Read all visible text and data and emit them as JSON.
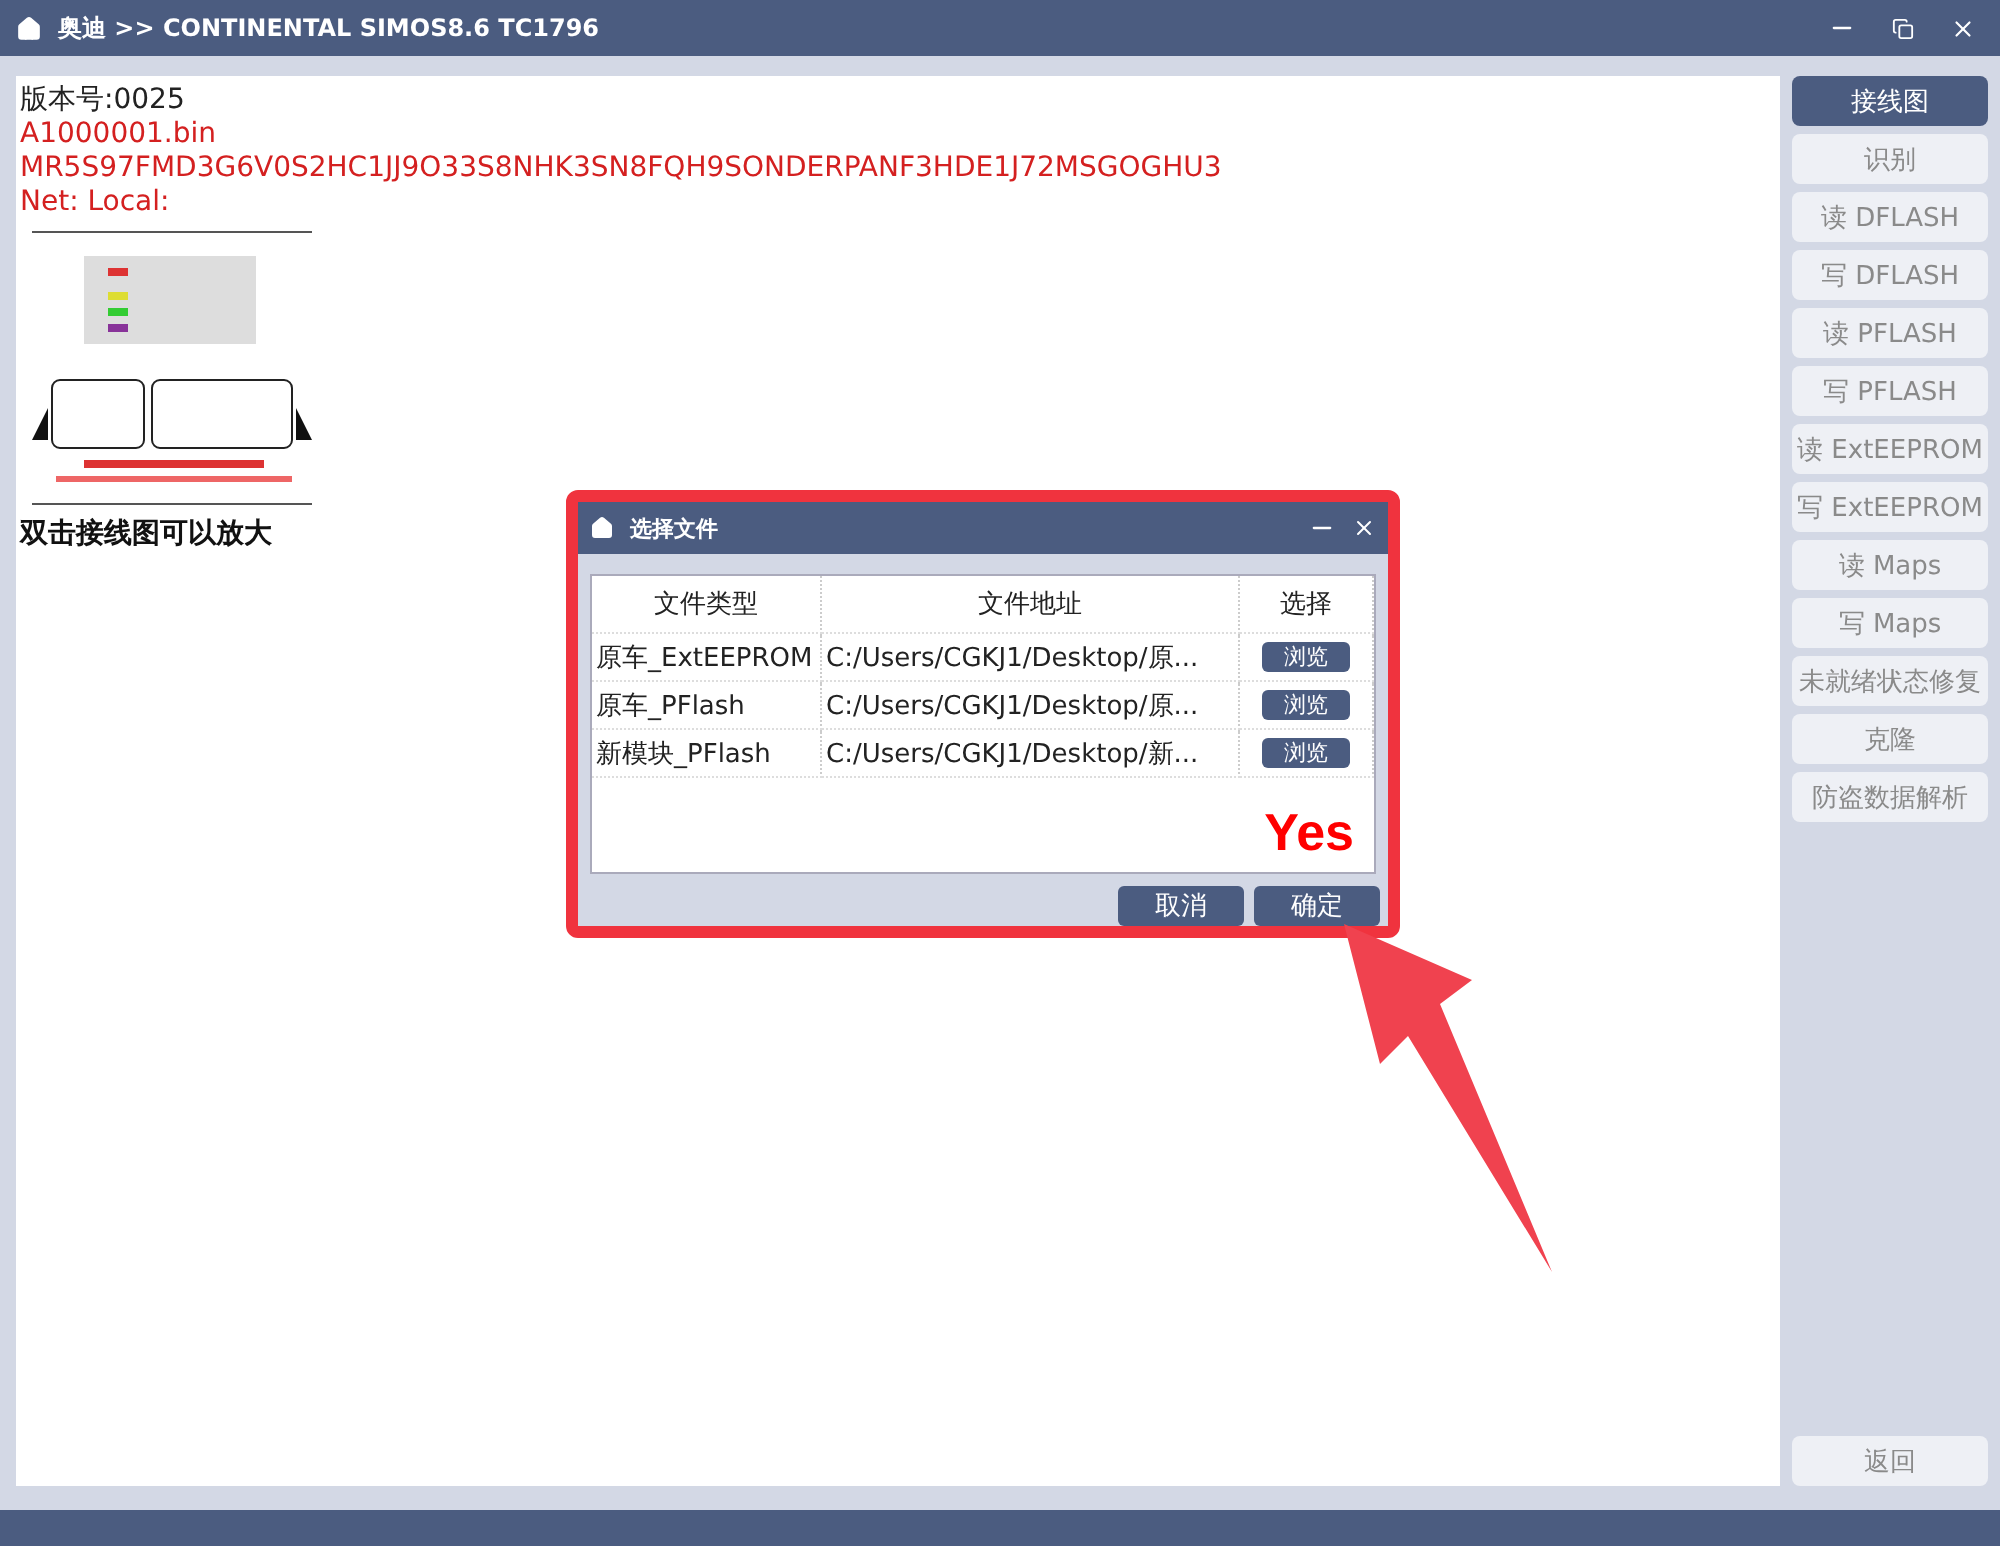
{
  "window": {
    "title": "奥迪 >> CONTINENTAL SIMOS8.6 TC1796"
  },
  "info": {
    "version": "版本号:0025",
    "lines": [
      "A1000001.bin",
      "MR5S97FMD3G6V0S2HC1JJ9O33S8NHK3SN8FQH9SONDERPANF3HDE1J72MSGOGHU3",
      "Net: Local:"
    ],
    "diagram": {
      "kind": "picture"
    },
    "hint": "双击接线图可以放大"
  },
  "sidebar": {
    "items": [
      {
        "label": "接线图",
        "selected": true,
        "disabled": false
      },
      {
        "label": "识别",
        "selected": false,
        "disabled": true
      },
      {
        "label": "读 DFLASH",
        "selected": false,
        "disabled": true
      },
      {
        "label": "写 DFLASH",
        "selected": false,
        "disabled": true
      },
      {
        "label": "读 PFLASH",
        "selected": false,
        "disabled": true
      },
      {
        "label": "写 PFLASH",
        "selected": false,
        "disabled": true
      },
      {
        "label": "读 ExtEEPROM",
        "selected": false,
        "disabled": true
      },
      {
        "label": "写 ExtEEPROM",
        "selected": false,
        "disabled": true
      },
      {
        "label": "读 Maps",
        "selected": false,
        "disabled": true
      },
      {
        "label": "写 Maps",
        "selected": false,
        "disabled": true
      },
      {
        "label": "未就绪状态修复",
        "selected": false,
        "disabled": true
      },
      {
        "label": "克隆",
        "selected": false,
        "disabled": true
      },
      {
        "label": "防盗数据解析",
        "selected": false,
        "disabled": true
      }
    ],
    "back": {
      "label": "返回",
      "disabled": true
    }
  },
  "dialog": {
    "title": "选择文件",
    "columns": [
      "文件类型",
      "文件地址",
      "选择"
    ],
    "rows": [
      {
        "type": "原车_ExtEEPROM",
        "path": "C:/Users/CGKJ1/Desktop/原...",
        "button": "浏览"
      },
      {
        "type": "原车_PFlash",
        "path": "C:/Users/CGKJ1/Desktop/原...",
        "button": "浏览"
      },
      {
        "type": "新模块_PFlash",
        "path": "C:/Users/CGKJ1/Desktop/新...",
        "button": "浏览"
      }
    ],
    "annotation": "Yes",
    "buttons": [
      "取消",
      "确定"
    ]
  }
}
